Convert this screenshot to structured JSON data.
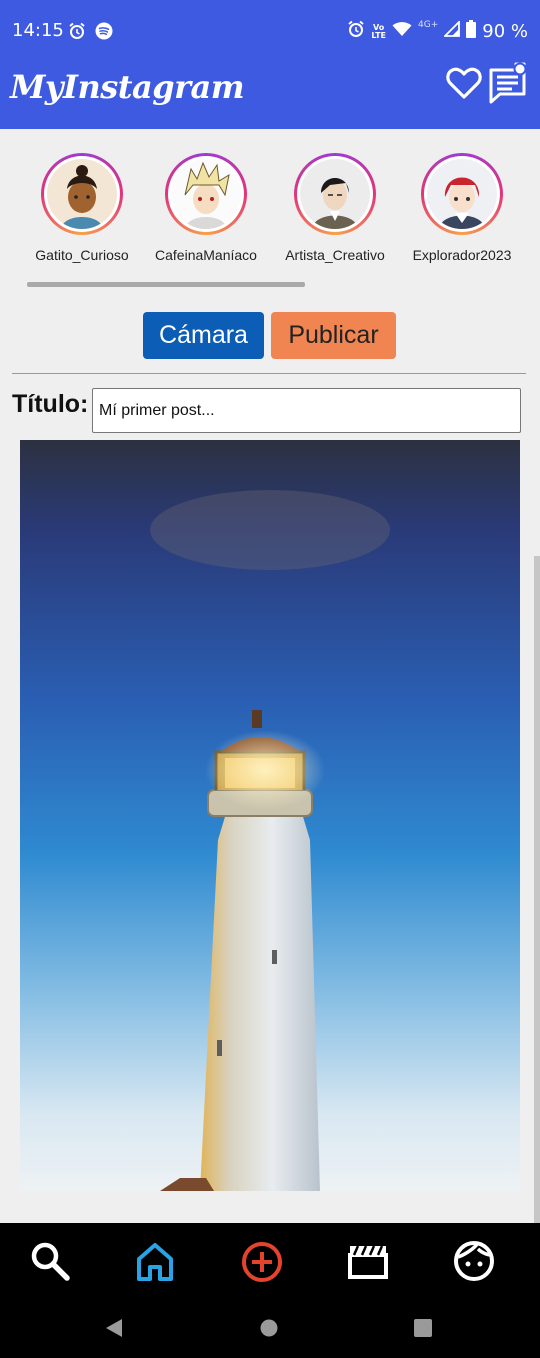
{
  "status": {
    "time": "14:15",
    "network_tag_top": "Vo",
    "network_tag_bottom": "LTE",
    "signal_tag": "4G+",
    "battery": "90 %"
  },
  "app": {
    "title": "MyInstagram"
  },
  "stories": [
    {
      "name": "Gatito_Curioso"
    },
    {
      "name": "CafeinaManíaco"
    },
    {
      "name": "Artista_Creativo"
    },
    {
      "name": "Explorador2023"
    }
  ],
  "actions": {
    "camera_label": "Cámara",
    "publish_label": "Publicar"
  },
  "post": {
    "title_label": "Título:",
    "title_value": "Mí primer post..."
  },
  "colors": {
    "primary": "#3d5ae0",
    "camera": "#0b5db5",
    "publish": "#f08552",
    "nav_active": "#29a3e6",
    "nav_add": "#e5432c"
  },
  "nav": {
    "search": "search-icon",
    "home": "home-icon",
    "add": "add-circle-icon",
    "reels": "clapperboard-icon",
    "profile": "face-icon"
  }
}
